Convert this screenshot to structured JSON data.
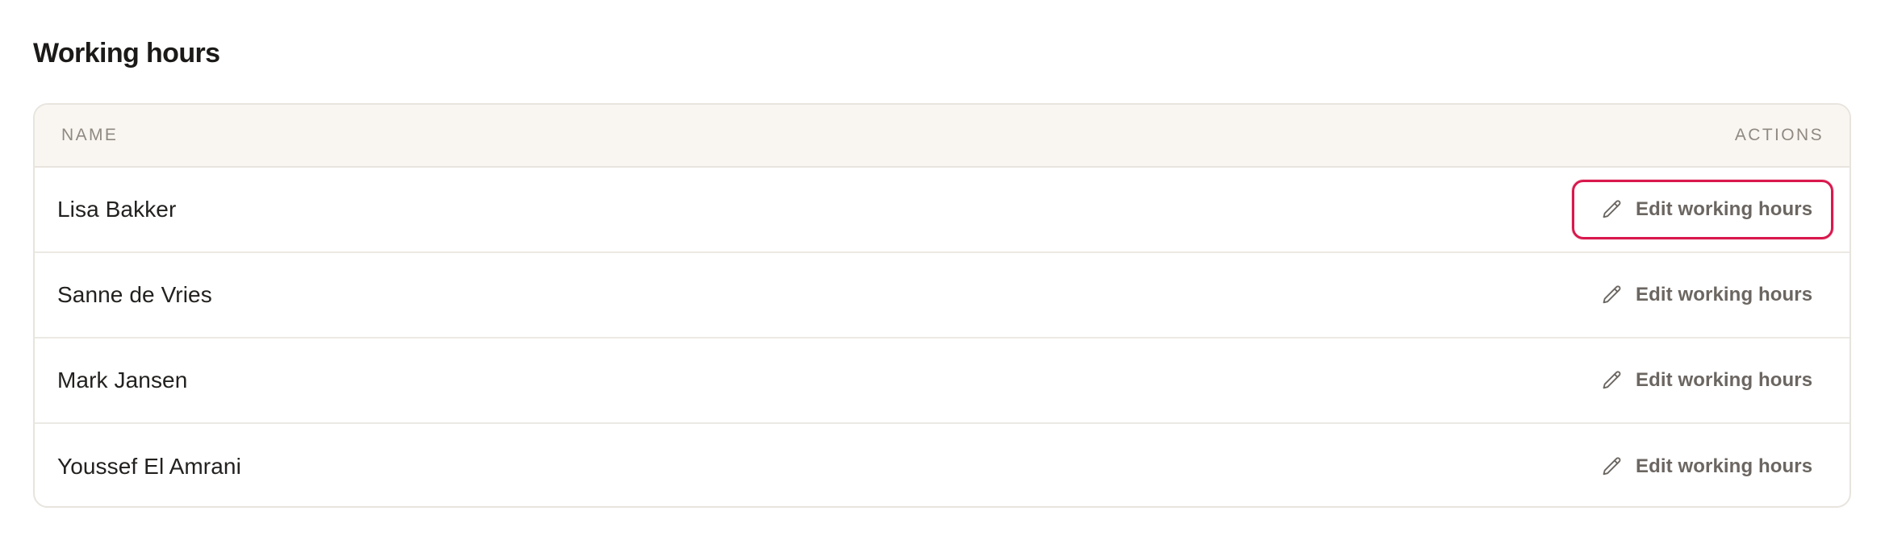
{
  "page": {
    "title": "Working hours"
  },
  "table": {
    "columns": {
      "name": "NAME",
      "actions": "ACTIONS"
    },
    "rows": [
      {
        "name": "Lisa Bakker",
        "action_label": "Edit working hours",
        "focused": true
      },
      {
        "name": "Sanne de Vries",
        "action_label": "Edit working hours",
        "focused": false
      },
      {
        "name": "Mark Jansen",
        "action_label": "Edit working hours",
        "focused": false
      },
      {
        "name": "Youssef El Amrani",
        "action_label": "Edit working hours",
        "focused": false
      }
    ]
  },
  "icons": {
    "edit": "pencil-icon"
  },
  "colors": {
    "focus_ring": "#d9184d",
    "header_bg": "#f9f6f1",
    "border": "#e8e4de",
    "muted_text": "#6b6661"
  }
}
